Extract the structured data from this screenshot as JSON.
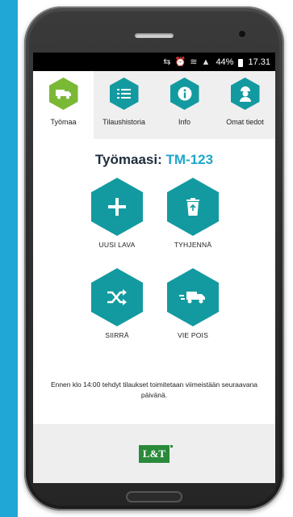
{
  "statusbar": {
    "icons": "⇆ ⏰ ≋ ▲",
    "battery": "44%",
    "time": "17.31"
  },
  "tabs": [
    {
      "label": "Työmaa",
      "icon": "truck-icon",
      "active": true
    },
    {
      "label": "Tilaushistoria",
      "icon": "list-icon",
      "active": false
    },
    {
      "label": "Info",
      "icon": "info-icon",
      "active": false
    },
    {
      "label": "Omat tiedot",
      "icon": "worker-icon",
      "active": false
    }
  ],
  "title": {
    "prefix": "Työmaasi:",
    "code": "TM-123"
  },
  "actions": [
    {
      "label": "UUSI LAVA",
      "icon": "plus-icon"
    },
    {
      "label": "TYHJENNÄ",
      "icon": "recycle-bin-icon"
    },
    {
      "label": "SIIRRÄ",
      "icon": "shuffle-icon"
    },
    {
      "label": "VIE POIS",
      "icon": "truck-away-icon"
    }
  ],
  "notice": "Ennen klo 14:00 tehdyt tilaukset toimitetaan viimeistään seuraavana päivänä.",
  "logo": "L&T",
  "colors": {
    "accent": "#139aa0",
    "active_tab": "#7ab935",
    "title_code": "#1ea8c9",
    "background": "#21a7d6"
  }
}
